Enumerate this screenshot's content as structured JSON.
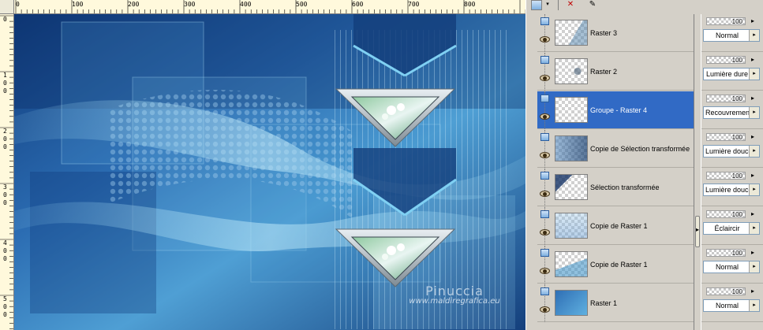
{
  "ruler": {
    "top_labels": [
      "0",
      "100",
      "200",
      "300",
      "400",
      "500",
      "600",
      "700",
      "800"
    ],
    "left_labels": [
      [
        "0"
      ],
      [
        "1",
        "0",
        "0"
      ],
      [
        "2",
        "0",
        "0"
      ],
      [
        "3",
        "0",
        "0"
      ],
      [
        "4",
        "0",
        "0"
      ],
      [
        "5",
        "0",
        "0"
      ]
    ]
  },
  "canvas": {
    "watermark_name": "Pinuccia",
    "watermark_url": "www.maldiregrafica.eu",
    "colors": {
      "deep": "#123a78",
      "mid": "#2f6fb5",
      "light": "#6cb6e0",
      "pale": "#b8e2f5"
    }
  },
  "palette": {
    "toolbar_icons": [
      "layer-type-icon",
      "dropdown-arrow-icon",
      "delete-layer-icon",
      "layer-properties-icon"
    ],
    "layers": [
      {
        "name": "Raster 3",
        "opacity": "100",
        "blend": "Normal",
        "selected": false
      },
      {
        "name": "Raster 2",
        "opacity": "100",
        "blend": "Lumière dure",
        "selected": false
      },
      {
        "name": "Groupe - Raster 4",
        "opacity": "100",
        "blend": "Recouvrement",
        "selected": true
      },
      {
        "name": "Copie de Sélection transformée",
        "opacity": "100",
        "blend": "Lumière douce",
        "selected": false
      },
      {
        "name": "Sélection transformée",
        "opacity": "100",
        "blend": "Lumière douce",
        "selected": false
      },
      {
        "name": "Copie de Raster 1",
        "opacity": "100",
        "blend": "Éclaircir",
        "selected": false
      },
      {
        "name": "Copie de Raster 1",
        "opacity": "100",
        "blend": "Normal",
        "selected": false
      },
      {
        "name": "Raster 1",
        "opacity": "100",
        "blend": "Normal",
        "selected": false
      }
    ],
    "colors": {
      "selection": "#316ac5"
    }
  }
}
